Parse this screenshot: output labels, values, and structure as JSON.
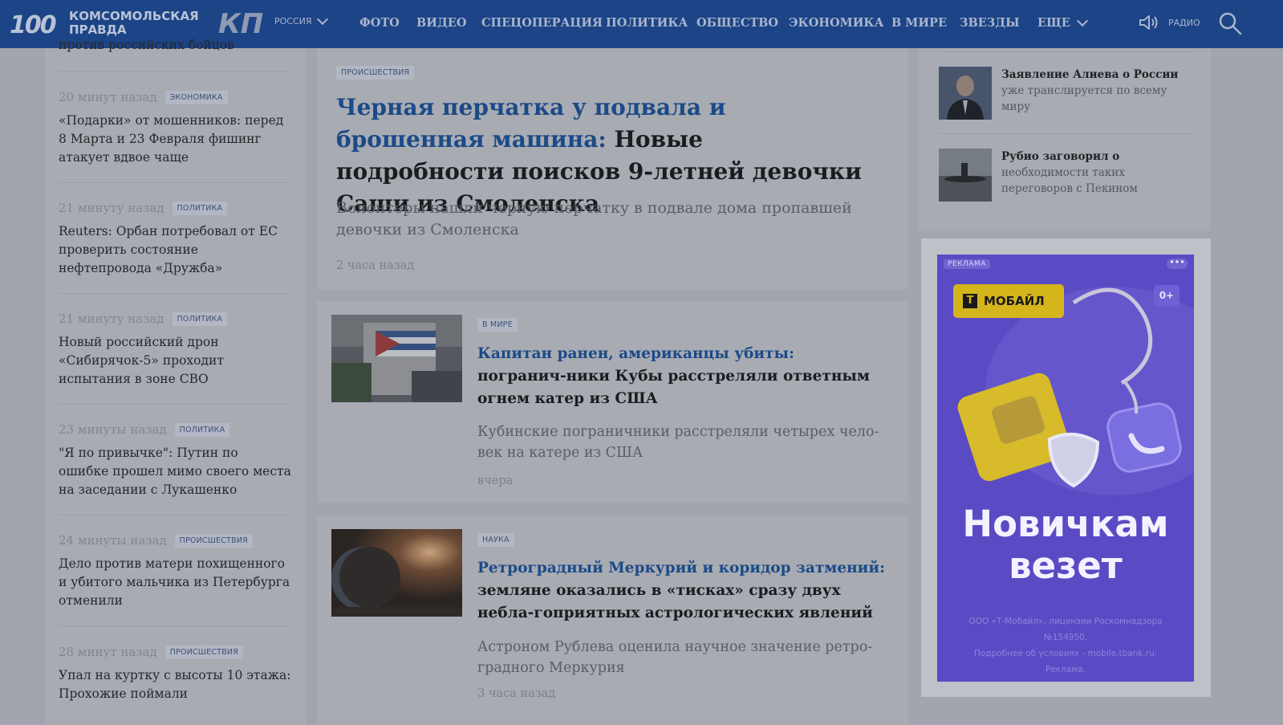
{
  "header": {
    "logo_100": "100",
    "logo_line1": "Комсомольская",
    "logo_line2": "правда",
    "region": "РОССИЯ",
    "nav": [
      "ФОТО",
      "ВИДЕО",
      "СПЕЦОПЕРАЦИЯ",
      "ПОЛИТИКА",
      "ОБЩЕСТВО",
      "ЭКОНОМИКА",
      "В МИРЕ",
      "ЗВЕЗДЫ"
    ],
    "more": "ЕЩЕ",
    "radio": "РАДИО",
    "icons": [
      "logo",
      "chevron-down-icon",
      "speaker-icon",
      "search-icon"
    ]
  },
  "left_feed": {
    "partial_title": "против российских бойцов",
    "items": [
      {
        "time": "20 минут назад",
        "tag": "ЭКОНОМИКА",
        "title": "«Подарки» от мошенников: перед 8 Марта и 23 Февраля фишинг атакует вдвое чаще"
      },
      {
        "time": "21 минуту назад",
        "tag": "ПОЛИТИКА",
        "title": "Reuters: Орбан потребовал от ЕС проверить состояние нефтепровода «Дружба»"
      },
      {
        "time": "21 минуту назад",
        "tag": "ПОЛИТИКА",
        "title": "Новый российский дрон «Сибирячок-5» проходит испытания в зоне СВО"
      },
      {
        "time": "23 минуты назад",
        "tag": "ПОЛИТИКА",
        "title": "\"Я по привычке\": Путин по ошибке прошел мимо своего места на заседании с Лукашенко"
      },
      {
        "time": "24 минуты назад",
        "tag": "ПРОИСШЕСТВИЯ",
        "title": "Дело против матери похищенного и убитого мальчика из Петербурга отменили"
      },
      {
        "time": "28 минут назад",
        "tag": "ПРОИСШЕСТВИЯ",
        "title": "Упал на куртку с высоты 10 этажа: Прохожие поймали"
      }
    ]
  },
  "main": {
    "lead": {
      "tag": "ПРОИСШЕСТВИЯ",
      "title_blue": "Черная перчатка у подвала и брошенная машина:",
      "title_black": " Новые подробности поисков 9-летней девочки Саши из Смоленска",
      "desc": "Волонтеры нашли черную перчатку в подвале дома пропавшей девочки из Смоленска",
      "time": "2 часа назад"
    },
    "articles": [
      {
        "tag": "В МИРЕ",
        "title_blue": "Капитан ранен, американцы убиты:",
        "title_black": " погранич-ники Кубы расстреляли ответным огнем катер из США",
        "desc": "Кубинские пограничники расстреляли четырех чело-век на катере из США",
        "time": "вчера",
        "image": "cuban-flag-photo"
      },
      {
        "tag": "НАУКА",
        "title_blue": "Ретроградный Меркурий и коридор затмений:",
        "title_black": " земляне оказались в «тисках» сразу двух небла-гоприятных астрологических явлений",
        "desc": "Астроном Рублева оценила научное значение ретро-градного Меркурия",
        "time": "3 часа назад",
        "image": "planet-photo"
      }
    ]
  },
  "right_feed": {
    "items": [
      {
        "bold": "Заявление Алиева о России",
        "rest": " уже транслируется по всему миру",
        "image": "aliyev-photo"
      },
      {
        "bold": "Рубио заговорил о",
        "rest": " необходимости таких переговоров с Пекином",
        "image": "submarine-photo"
      }
    ]
  },
  "ad": {
    "label": "РЕКЛАМА",
    "menu": "•••",
    "brand_t": "Т",
    "brand": "МОБАЙЛ",
    "age": "0+",
    "headline1": "Новичкам",
    "headline2": "везет",
    "legal1": "ООО «Т-Мобайл», лицензии Роскомнадзора №154950.",
    "legal2": "Подробнее об условиях - mobile.tbank.ru. Реклама.",
    "colors": {
      "bg": "#5a4bc4",
      "brand": "#d5b51c"
    }
  }
}
